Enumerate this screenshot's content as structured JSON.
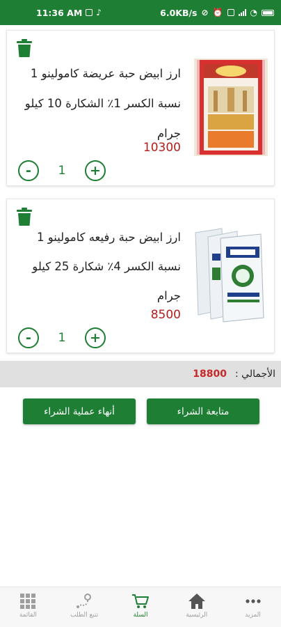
{
  "status_bar": {
    "time": "11:36 AM",
    "network_speed": "6.0KB/s",
    "icons": [
      "message-icon",
      "tiktok-icon",
      "vibrate-off-icon",
      "alarm-icon",
      "sim-icon",
      "signal-icon",
      "wifi-icon",
      "battery-icon"
    ]
  },
  "cart_items": [
    {
      "description": "ارز ابيض حبة عريضة كامولينو 1 نسبة الكسر 1٪ الشكارة 10 كيلو جرام",
      "price": "10300",
      "quantity": "1",
      "image": "rice-bag-red-image"
    },
    {
      "description": "ارز ابيض حبة رفيعه كامولينو 1 نسبة الكسر 4٪ شكارة 25 كيلو جرام",
      "price": "8500",
      "quantity": "1",
      "image": "rice-bags-blue-image"
    }
  ],
  "qty_controls": {
    "minus": "-",
    "plus": "+"
  },
  "total": {
    "label": "الأجمالي :",
    "value": "18800"
  },
  "actions": {
    "continue_label": "متابعة الشراء",
    "end_label": "أنهاء عملية الشراء"
  },
  "bottom_nav": [
    {
      "label": "المزيد",
      "icon": "more-dots-icon",
      "active": false
    },
    {
      "label": "الرئيسية",
      "icon": "home-icon",
      "active": false
    },
    {
      "label": "السلة",
      "icon": "cart-icon",
      "active": true
    },
    {
      "label": "تتبع الطلب",
      "icon": "track-order-icon",
      "active": false
    },
    {
      "label": "القائمة",
      "icon": "grid-menu-icon",
      "active": false
    }
  ],
  "colors": {
    "primary": "#1e7e34",
    "price": "#b71c1c",
    "total_value": "#c62828",
    "total_bar": "#e0e0e0"
  }
}
